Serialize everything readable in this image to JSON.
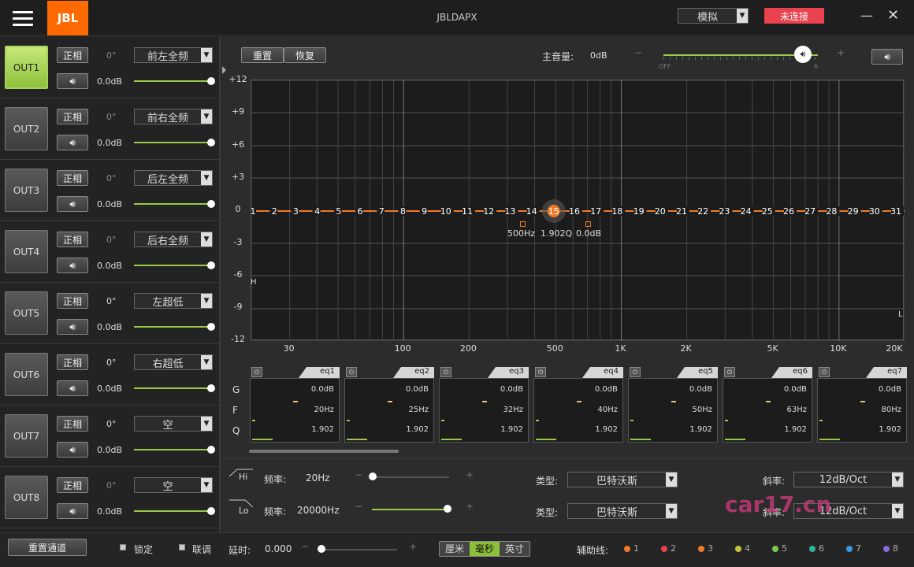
{
  "app": {
    "logo": "JBL",
    "title": "JBLDAPX",
    "mode": "模拟",
    "status": "未连接"
  },
  "outputs": [
    {
      "label": "OUT1",
      "phase": "正相",
      "degree": "0°",
      "channel": "前左全频",
      "gain": "0.0dB",
      "active": true,
      "deg_on": false
    },
    {
      "label": "OUT2",
      "phase": "正相",
      "degree": "0°",
      "channel": "前右全频",
      "gain": "0.0dB",
      "active": false,
      "deg_on": false
    },
    {
      "label": "OUT3",
      "phase": "正相",
      "degree": "0°",
      "channel": "后左全频",
      "gain": "0.0dB",
      "active": false,
      "deg_on": false
    },
    {
      "label": "OUT4",
      "phase": "正相",
      "degree": "0°",
      "channel": "后右全频",
      "gain": "0.0dB",
      "active": false,
      "deg_on": false
    },
    {
      "label": "OUT5",
      "phase": "正相",
      "degree": "0°",
      "channel": "左超低",
      "gain": "0.0dB",
      "active": false,
      "deg_on": true
    },
    {
      "label": "OUT6",
      "phase": "正相",
      "degree": "0°",
      "channel": "右超低",
      "gain": "0.0dB",
      "active": false,
      "deg_on": true
    },
    {
      "label": "OUT7",
      "phase": "正相",
      "degree": "0°",
      "channel": "空",
      "gain": "0.0dB",
      "active": false,
      "deg_on": true
    },
    {
      "label": "OUT8",
      "phase": "正相",
      "degree": "0°",
      "channel": "空",
      "gain": "0.0dB",
      "active": false,
      "deg_on": false
    }
  ],
  "toolbar": {
    "reset": "重置",
    "restore": "恢复",
    "master_label": "主音量:",
    "master_value": "0dB",
    "master_min": "OFF",
    "master_max": "6",
    "minus": "−",
    "plus": "+"
  },
  "graph": {
    "y_ticks": [
      "+12",
      "+9",
      "+6",
      "+3",
      "0",
      "-3",
      "-6",
      "-9",
      "-12"
    ],
    "x_ticks": [
      "30",
      "100",
      "200",
      "500",
      "1K",
      "2K",
      "5K",
      "10K",
      "20K"
    ],
    "points": [
      "1",
      "2",
      "3",
      "4",
      "5",
      "6",
      "7",
      "8",
      "9",
      "10",
      "11",
      "12",
      "13",
      "14",
      "15",
      "16",
      "17",
      "18",
      "19",
      "20",
      "21",
      "22",
      "23",
      "24",
      "25",
      "26",
      "27",
      "28",
      "29",
      "30",
      "31"
    ],
    "selected_point": "15",
    "info_freq": "500Hz",
    "info_q": "1.902Q",
    "info_gain": "0.0dB",
    "hp_marker": "H",
    "lp_marker": "L"
  },
  "eq_rows": {
    "g": "G",
    "f": "F",
    "q": "Q"
  },
  "eq": [
    {
      "name": "eq1",
      "gain": "0.0dB",
      "freq": "20Hz",
      "q": "1.902"
    },
    {
      "name": "eq2",
      "gain": "0.0dB",
      "freq": "25Hz",
      "q": "1.902"
    },
    {
      "name": "eq3",
      "gain": "0.0dB",
      "freq": "32Hz",
      "q": "1.902"
    },
    {
      "name": "eq4",
      "gain": "0.0dB",
      "freq": "40Hz",
      "q": "1.902"
    },
    {
      "name": "eq5",
      "gain": "0.0dB",
      "freq": "50Hz",
      "q": "1.902"
    },
    {
      "name": "eq6",
      "gain": "0.0dB",
      "freq": "63Hz",
      "q": "1.902"
    },
    {
      "name": "eq7",
      "gain": "0.0dB",
      "freq": "80Hz",
      "q": "1.902"
    }
  ],
  "filters": {
    "hi": {
      "tag": "Hi",
      "freq_label": "频率:",
      "freq": "20Hz",
      "type_label": "类型:",
      "type": "巴特沃斯",
      "slope_label": "斜率:",
      "slope": "12dB/Oct"
    },
    "lo": {
      "tag": "Lo",
      "freq_label": "频率:",
      "freq": "20000Hz",
      "type_label": "类型:",
      "type": "巴特沃斯",
      "slope_label": "斜率:",
      "slope": "12dB/Oct"
    }
  },
  "bottom": {
    "reset_channel": "重置通道",
    "lock": "锁定",
    "link": "联调",
    "delay_label": "延时:",
    "delay_value": "0.000",
    "units": [
      "厘米",
      "毫秒",
      "英寸"
    ],
    "unit_selected": "毫秒",
    "aux_label": "辅助线:",
    "aux": [
      {
        "n": "1",
        "color": "#f07a2a"
      },
      {
        "n": "2",
        "color": "#e8434f"
      },
      {
        "n": "3",
        "color": "#f07a2a"
      },
      {
        "n": "4",
        "color": "#c9c23a"
      },
      {
        "n": "5",
        "color": "#7bc94a"
      },
      {
        "n": "6",
        "color": "#2fb3a0"
      },
      {
        "n": "7",
        "color": "#3a9be0"
      },
      {
        "n": "8",
        "color": "#8a6ad8"
      }
    ]
  },
  "watermark": "car17.cn",
  "colors": {
    "accent": "#8dc03a",
    "brand": "#ff6a00",
    "curve": "#f07a2a",
    "alert": "#e8434f"
  }
}
